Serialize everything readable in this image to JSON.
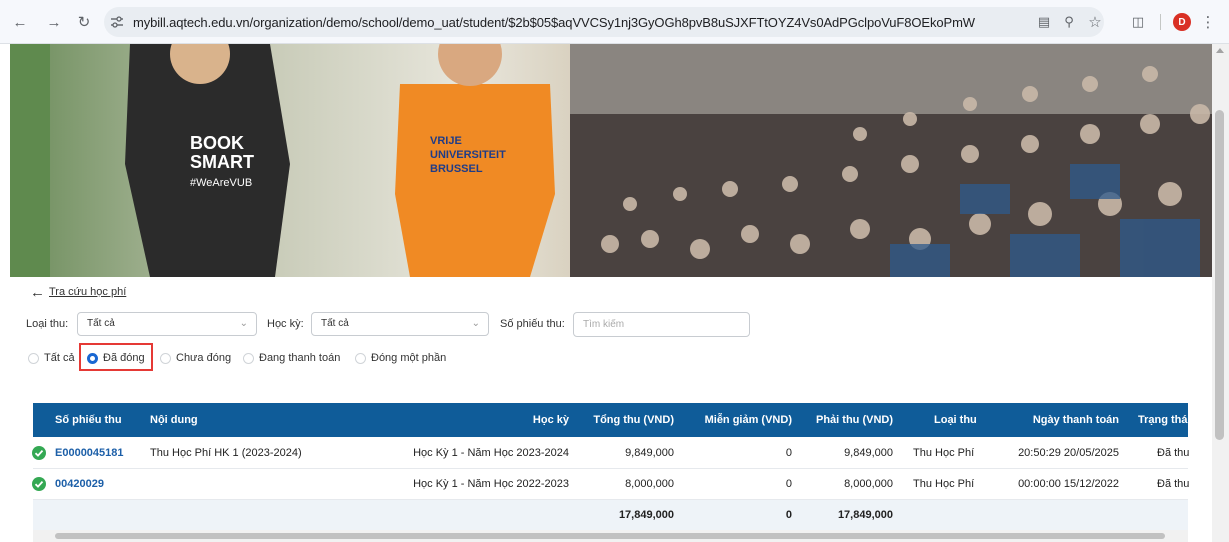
{
  "browser": {
    "url": "mybill.aqtech.edu.vn/organization/demo/school/demo_uat/student/$2b$05$aqVVCSy1nj3GyOGh8pvB8uSJXFTtOYZ4Vs0AdPGclpoVuF8OEkoPmW",
    "profile_initial": "D"
  },
  "page": {
    "back_link": "Tra cứu học phí"
  },
  "filters": {
    "type_label": "Loại thu:",
    "type_value": "Tất cả",
    "term_label": "Học kỳ:",
    "term_value": "Tất cả",
    "receipt_label": "Số phiếu thu:",
    "receipt_placeholder": "Tìm kiếm"
  },
  "status_options": [
    {
      "label": "Tất cả",
      "selected": false
    },
    {
      "label": "Đã đóng",
      "selected": true
    },
    {
      "label": "Chưa đóng",
      "selected": false
    },
    {
      "label": "Đang thanh toán",
      "selected": false
    },
    {
      "label": "Đóng một phần",
      "selected": false
    }
  ],
  "table": {
    "headers": [
      "Số phiếu thu",
      "Nội dung",
      "Học kỳ",
      "Tổng thu (VND)",
      "Miễn giảm (VND)",
      "Phải thu (VND)",
      "Loại thu",
      "Ngày thanh toán",
      "Trạng thái"
    ],
    "rows": [
      {
        "receipt": "E0000045181",
        "content": "Thu Học Phí HK 1 (2023-2024)",
        "term": "Học Kỳ 1 - Năm Học 2023-2024",
        "total": "9,849,000",
        "discount": "0",
        "payable": "9,849,000",
        "type": "Thu Học Phí",
        "paid_at": "20:50:29 20/05/2025",
        "status": "Đã thu"
      },
      {
        "receipt": "00420029",
        "content": "",
        "term": "Học Kỳ 1 - Năm Học 2022-2023",
        "total": "8,000,000",
        "discount": "0",
        "payable": "8,000,000",
        "type": "Thu Học Phí",
        "paid_at": "00:00:00 15/12/2022",
        "status": "Đã thu"
      }
    ],
    "totals": {
      "total": "17,849,000",
      "discount": "0",
      "payable": "17,849,000"
    }
  },
  "colors": {
    "header_bg": "#0f5c99",
    "accent": "#1967d2",
    "success": "#34a853",
    "highlight": "#e53935"
  }
}
